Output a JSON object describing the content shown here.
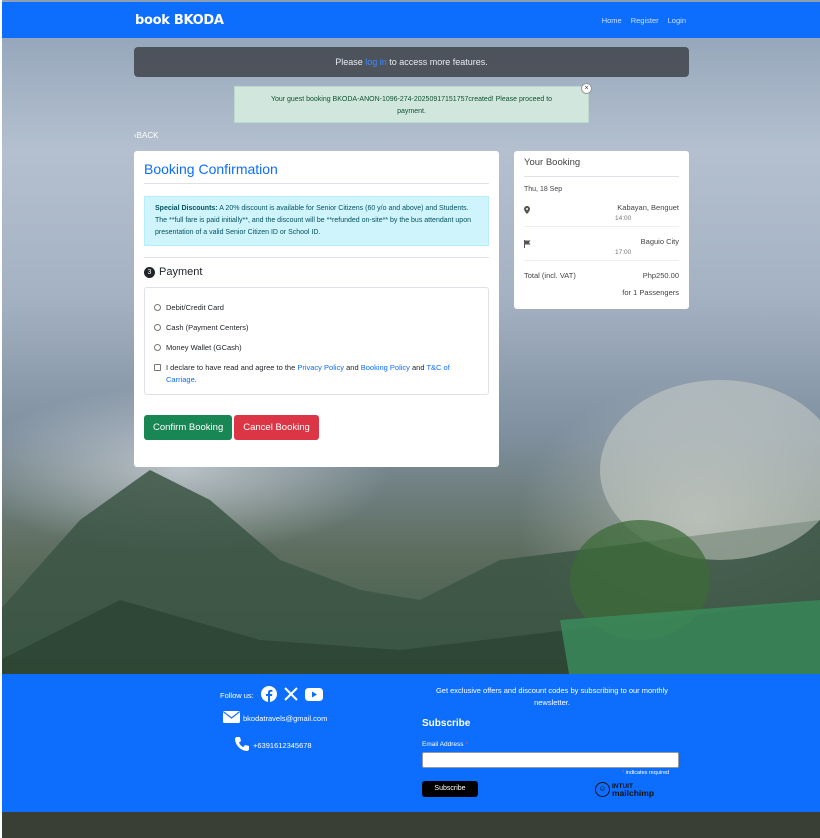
{
  "brand": "book BKODA",
  "nav": {
    "home": "Home",
    "register": "Register",
    "login": "Login"
  },
  "notice": {
    "before": "Please ",
    "link": "log in",
    "after": " to access more features."
  },
  "alert": {
    "message": "Your guest booking BKODA-ANON-1096-274-20250917151757created! Please proceed to payment.",
    "close": "×"
  },
  "back_label": "BACK",
  "booking": {
    "title": "Booking Confirmation",
    "discount_label": "Special Discounts:",
    "discount_text": " A 20% discount is available for Senior Citizens (60 y/o and above) and Students.",
    "discount_note": "The **full fare is paid initially**, and the discount will be **refunded on-site** by the bus attendant upon presentation of a valid Senior Citizen ID or School ID.",
    "payment_step": "3",
    "payment_title": "Payment",
    "options": [
      "Debit/Credit Card",
      "Cash (Payment Centers)",
      "Money Wallet (GCash)"
    ],
    "agree_prefix": "I declare to have read and agree to the ",
    "privacy_policy": "Privacy Policy",
    "and1": " and ",
    "booking_policy": "Booking Policy",
    "and2": " and ",
    "tnc": "T&C of Carriage",
    "period": ".",
    "confirm_button": "Confirm Booking",
    "cancel_button": "Cancel Booking"
  },
  "your_booking": {
    "title": "Your Booking",
    "date": "Thu, 18 Sep",
    "origin": "Kabayan, Benguet",
    "origin_time": "14:00",
    "destination": "Baguio City",
    "destination_time": "17:00",
    "total_label": "Total (incl. VAT)",
    "total_value": "Php250.00",
    "passengers": "for 1 Passengers"
  },
  "footer": {
    "follow_label": "Follow us:",
    "email": "bkodatravels@gmail.com",
    "phone": "+6391612345678",
    "offer_text": "Get exclusive offers and discount codes by subscribing to our monthly newsletter.",
    "subscribe_title": "Subscribe",
    "email_label": "Email Address ",
    "required_mark": "*",
    "indicates_required": " indicates required",
    "subscribe_button": "Subscribe",
    "mailchimp_top": "INTUIT",
    "mailchimp_bottom": "mailchimp"
  },
  "colors": {
    "primary": "#0d6efd",
    "success": "#198754",
    "danger": "#dc3545",
    "info_bg": "#cff4fc",
    "alert_bg": "#d1e7dd"
  },
  "icons": {
    "location": "map-marker-icon",
    "destination": "flag-icon",
    "facebook": "facebook-icon",
    "x": "x-icon",
    "youtube": "youtube-icon",
    "email": "envelope-icon",
    "phone": "phone-icon"
  }
}
